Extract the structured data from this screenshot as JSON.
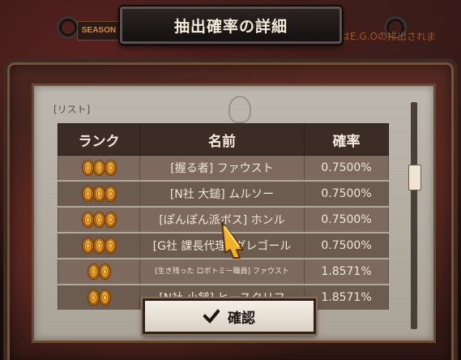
{
  "header": {
    "title": "抽出確率の詳細"
  },
  "background": {
    "sign_text": "SEASON",
    "notice_text": "はE.G.Oの排出されま"
  },
  "sheet": {
    "caption": "[リスト]",
    "table": {
      "headers": {
        "rank": "ランク",
        "name": "名前",
        "rate": "確率"
      },
      "rows": [
        {
          "rank_level": 3,
          "name": "[握る者] ファウスト",
          "rate": "0.7500%"
        },
        {
          "rank_level": 3,
          "name": "[N社 大鎚] ムルソー",
          "rate": "0.7500%"
        },
        {
          "rank_level": 3,
          "name": "[ぽんぽん派ボス] ホンル",
          "rate": "0.7500%"
        },
        {
          "rank_level": 3,
          "name": "[G社 課長代理] グレゴール",
          "rate": "0.7500%"
        },
        {
          "rank_level": 2,
          "name": "[生き残った ロボトミー職員] ファウスト",
          "rate": "1.8571%"
        },
        {
          "rank_level": 2,
          "name": "[N社 小鎚] ヒースクリフ",
          "rate": "1.8571%"
        }
      ]
    }
  },
  "buttons": {
    "confirm_label": "確認"
  },
  "colors": {
    "accent_gold": "#f3a21a",
    "table_header_bg": "#3c2c26",
    "row_bg": "#7b6a5d",
    "button_bg": "#f4efe6"
  },
  "icons": {
    "rank": "rank-gem-icon",
    "confirm": "check-icon",
    "pointer": "cursor-pointer-icon"
  }
}
